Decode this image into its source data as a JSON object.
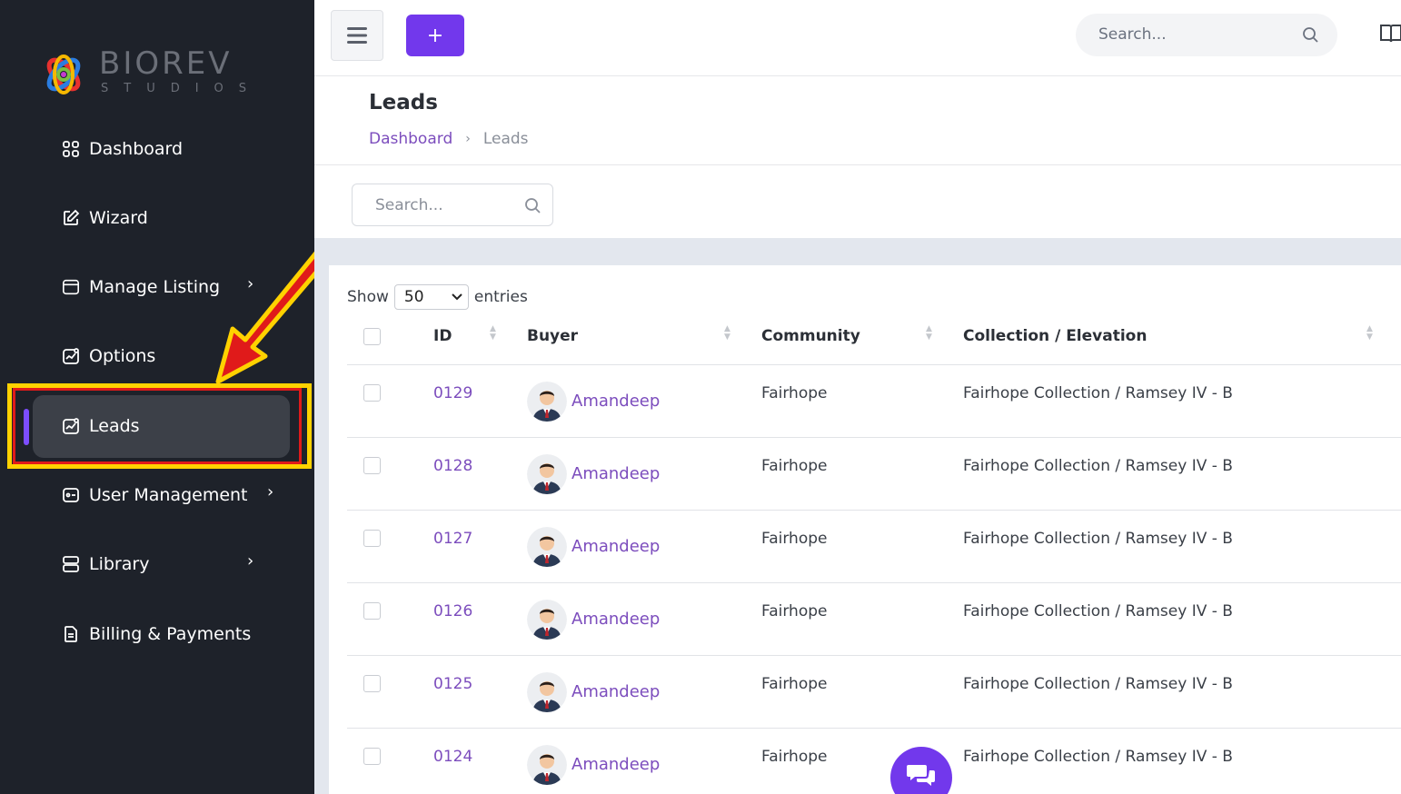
{
  "brand": {
    "name": "BIOREV",
    "subtitle": "STUDIOS"
  },
  "sidebar": {
    "items": [
      {
        "label": "Dashboard",
        "icon": "grid-icon",
        "has_submenu": false
      },
      {
        "label": "Wizard",
        "icon": "edit-icon",
        "has_submenu": false
      },
      {
        "label": "Manage Listing",
        "icon": "folder-icon",
        "has_submenu": true
      },
      {
        "label": "Options",
        "icon": "chart-icon",
        "has_submenu": false
      },
      {
        "label": "Leads",
        "icon": "chart-icon",
        "has_submenu": false,
        "active": true
      },
      {
        "label": "User Management",
        "icon": "user-card-icon",
        "has_submenu": true
      },
      {
        "label": "Library",
        "icon": "server-icon",
        "has_submenu": true
      },
      {
        "label": "Billing & Payments",
        "icon": "document-icon",
        "has_submenu": false
      }
    ]
  },
  "topbar": {
    "add_label": "+",
    "search_placeholder": "Search..."
  },
  "page": {
    "title": "Leads",
    "breadcrumb": {
      "parent": "Dashboard",
      "separator": "›",
      "current": "Leads"
    }
  },
  "filter": {
    "search_placeholder": "Search..."
  },
  "entries": {
    "show_label": "Show",
    "value": "50",
    "suffix": "entries"
  },
  "table": {
    "columns": [
      "ID",
      "Buyer",
      "Community",
      "Collection / Elevation"
    ],
    "rows": [
      {
        "id": "0129",
        "buyer": "Amandeep",
        "community": "Fairhope",
        "collection": "Fairhope Collection / Ramsey IV - B"
      },
      {
        "id": "0128",
        "buyer": "Amandeep",
        "community": "Fairhope",
        "collection": "Fairhope Collection / Ramsey IV - B"
      },
      {
        "id": "0127",
        "buyer": "Amandeep",
        "community": "Fairhope",
        "collection": "Fairhope Collection / Ramsey IV - B"
      },
      {
        "id": "0126",
        "buyer": "Amandeep",
        "community": "Fairhope",
        "collection": "Fairhope Collection / Ramsey IV - B"
      },
      {
        "id": "0125",
        "buyer": "Amandeep",
        "community": "Fairhope",
        "collection": "Fairhope Collection / Ramsey IV - B"
      },
      {
        "id": "0124",
        "buyer": "Amandeep",
        "community": "Fairhope",
        "collection": "Fairhope Collection / Ramsey IV - B"
      }
    ]
  },
  "colors": {
    "sidebar_bg": "#1e222a",
    "accent": "#7238ec",
    "link": "#7c4dbd",
    "highlight_yellow": "#ffd200",
    "highlight_red": "#e01a1a"
  }
}
